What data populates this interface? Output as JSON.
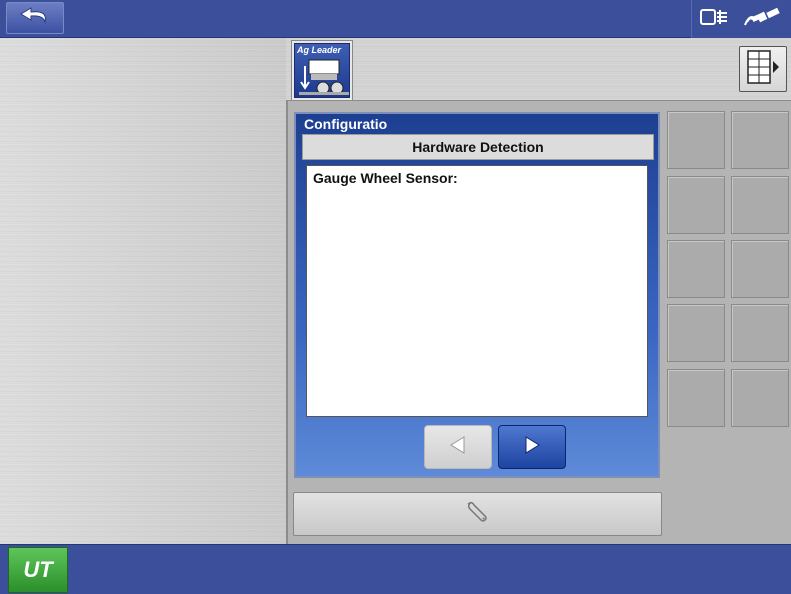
{
  "topbar": {
    "icons": [
      "back-arrow-icon",
      "display-module-icon",
      "gps-satellite-icon"
    ]
  },
  "tab": {
    "brand_label": "Ag Leader",
    "icon": "planter-configuration-icon"
  },
  "layout_button": {
    "icon": "layout-grid-icon"
  },
  "dialog": {
    "title": "Configuratio",
    "header": "Hardware Detection",
    "content_text": "Gauge Wheel Sensor:",
    "prev_icon": "left-arrow-icon",
    "next_icon": "right-arrow-icon"
  },
  "wrench_button": {
    "icon": "wrench-icon"
  },
  "bottombar": {
    "ut_label": "UT"
  },
  "colors": {
    "bar_blue": "#3b4f9a",
    "dialog_blue": "#1d3f91",
    "ut_green": "#3aa23a"
  }
}
